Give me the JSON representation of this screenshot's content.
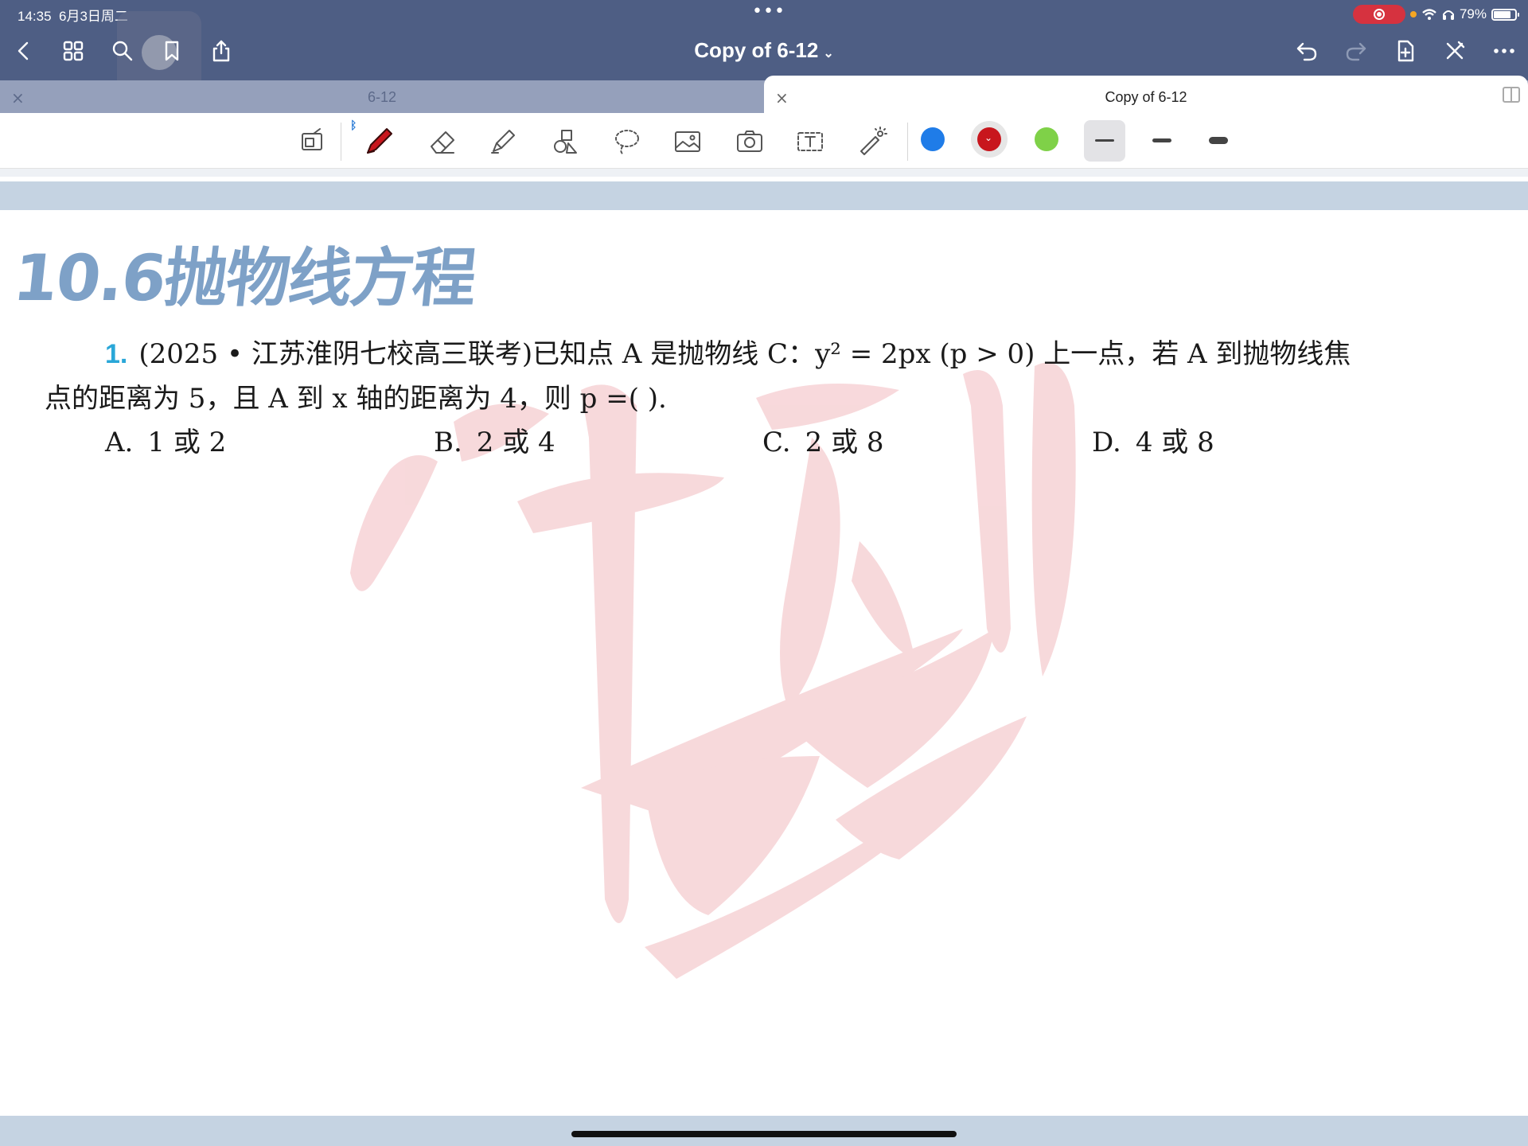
{
  "status_bar": {
    "time": "14:35",
    "date": "6月3日周二",
    "center_dots": "•••",
    "battery": "79%",
    "battery_level": 0.79
  },
  "toolbar": {
    "title": "Copy of 6-12",
    "title_chevron": "⌄",
    "left_icons": [
      "back-icon",
      "grid-icon",
      "search-icon",
      "bookmark-icon",
      "share-icon"
    ],
    "right_icons": [
      "undo-icon",
      "redo-icon",
      "add-page-icon",
      "close-pen-icon",
      "more-icon"
    ]
  },
  "tabs": [
    {
      "label": "6-12",
      "active": false,
      "close": "×"
    },
    {
      "label": "Copy of 6-12",
      "active": true,
      "close": "×"
    }
  ],
  "tools": {
    "items": [
      "zoom-window-icon",
      "pen-icon",
      "eraser-icon",
      "highlighter-icon",
      "shapes-icon",
      "lasso-icon",
      "image-icon",
      "camera-icon",
      "text-box-icon",
      "laser-pointer-icon"
    ],
    "bluetooth_mark": "ᛒ",
    "colors": [
      "#1f7ce8",
      "#c8161d",
      "#7fd148"
    ],
    "selected_color": "#c8161d",
    "widths": [
      "thin",
      "medium",
      "thick"
    ],
    "selected_width": "thin"
  },
  "page": {
    "section_title": "10.6抛物线方程",
    "question": {
      "number": "1.",
      "line1": "(2025 • 江苏淮阴七校高三联考)已知点 A 是抛物线 C：y² = 2px (p > 0) 上一点，若 A 到抛物线焦",
      "line2": "点的距离为 5，且 A 到 x 轴的距离为 4，则 p =(        )."
    },
    "options": [
      {
        "letter": "A.",
        "text": "1 或 2"
      },
      {
        "letter": "B.",
        "text": "2 或 4"
      },
      {
        "letter": "C.",
        "text": "2 或 8"
      },
      {
        "letter": "D.",
        "text": "4 或 8"
      }
    ]
  }
}
